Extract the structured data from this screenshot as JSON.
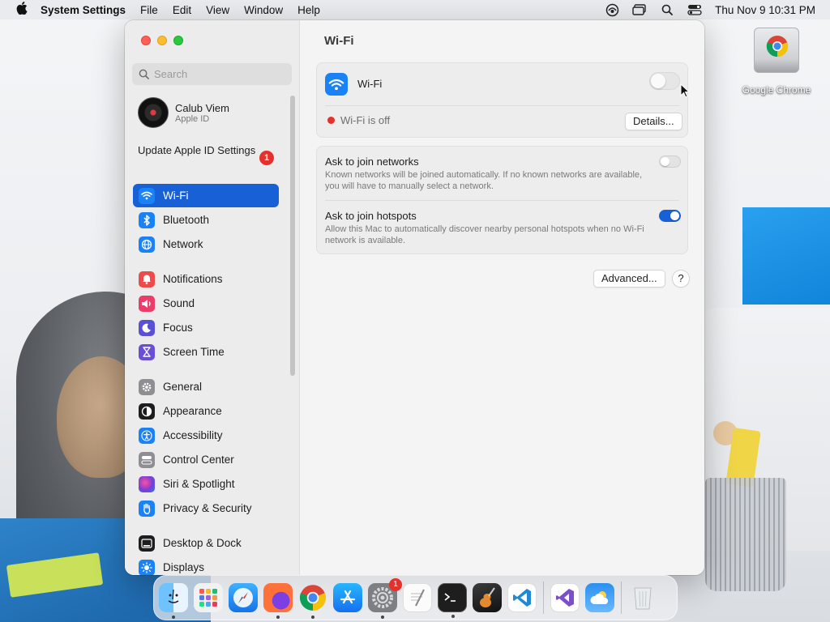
{
  "menubar": {
    "app_name": "System Settings",
    "menus": [
      "File",
      "Edit",
      "View",
      "Window",
      "Help"
    ],
    "clock": "Thu Nov 9  10:31 PM"
  },
  "desktop": {
    "chrome_label": "Google Chrome"
  },
  "window": {
    "search_placeholder": "Search",
    "account": {
      "name": "Calub Viem",
      "sub": "Apple ID"
    },
    "update_notice": {
      "label": "Update Apple ID Settings",
      "badge": "1"
    },
    "sidebar": {
      "items": [
        {
          "label": "Wi-Fi",
          "icon": "wifi-icon",
          "color": "#1a82f7",
          "selected": true
        },
        {
          "label": "Bluetooth",
          "icon": "bluetooth-icon",
          "color": "#1a82f7"
        },
        {
          "label": "Network",
          "icon": "globe-icon",
          "color": "#1a82f7"
        },
        {
          "label": "Notifications",
          "icon": "bell-icon",
          "color": "#ef4a4a"
        },
        {
          "label": "Sound",
          "icon": "speaker-icon",
          "color": "#ec3d6a"
        },
        {
          "label": "Focus",
          "icon": "moon-icon",
          "color": "#5b4fd6"
        },
        {
          "label": "Screen Time",
          "icon": "hourglass-icon",
          "color": "#6a4fd6"
        },
        {
          "label": "General",
          "icon": "gear-icon",
          "color": "#8e8e93"
        },
        {
          "label": "Appearance",
          "icon": "appearance-icon",
          "color": "#1d1d1f"
        },
        {
          "label": "Accessibility",
          "icon": "accessibility-icon",
          "color": "#1a82f7"
        },
        {
          "label": "Control Center",
          "icon": "control-center-icon",
          "color": "#8e8e93"
        },
        {
          "label": "Siri & Spotlight",
          "icon": "siri-icon",
          "color": "#7a3cd6"
        },
        {
          "label": "Privacy & Security",
          "icon": "hand-icon",
          "color": "#1a82f7"
        },
        {
          "label": "Desktop & Dock",
          "icon": "dock-icon",
          "color": "#1d1d1f"
        },
        {
          "label": "Displays",
          "icon": "sun-icon",
          "color": "#1a82f7"
        }
      ]
    },
    "main": {
      "title": "Wi-Fi",
      "wifi_row": {
        "label": "Wi-Fi",
        "enabled": false
      },
      "status": {
        "text": "Wi-Fi is off",
        "dot_color": "#e6302b"
      },
      "details_button": "Details...",
      "ask_networks": {
        "title": "Ask to join networks",
        "desc": "Known networks will be joined automatically. If no known networks are available, you will have to manually select a network.",
        "enabled": false
      },
      "ask_hotspots": {
        "title": "Ask to join hotspots",
        "desc": "Allow this Mac to automatically discover nearby personal hotspots when no Wi-Fi network is available.",
        "enabled": true
      },
      "advanced_button": "Advanced...",
      "help_button": "?"
    }
  },
  "dock": {
    "apps": [
      {
        "name": "finder",
        "running": true
      },
      {
        "name": "launchpad"
      },
      {
        "name": "safari"
      },
      {
        "name": "firefox",
        "running": true
      },
      {
        "name": "chrome",
        "running": true
      },
      {
        "name": "app-store"
      },
      {
        "name": "system-settings",
        "running": true,
        "badge": "1"
      },
      {
        "name": "textedit"
      },
      {
        "name": "terminal",
        "running": true
      },
      {
        "name": "garageband"
      },
      {
        "name": "vscode"
      },
      {
        "name": "visual-studio"
      },
      {
        "name": "weather"
      },
      {
        "name": "trash"
      }
    ]
  }
}
